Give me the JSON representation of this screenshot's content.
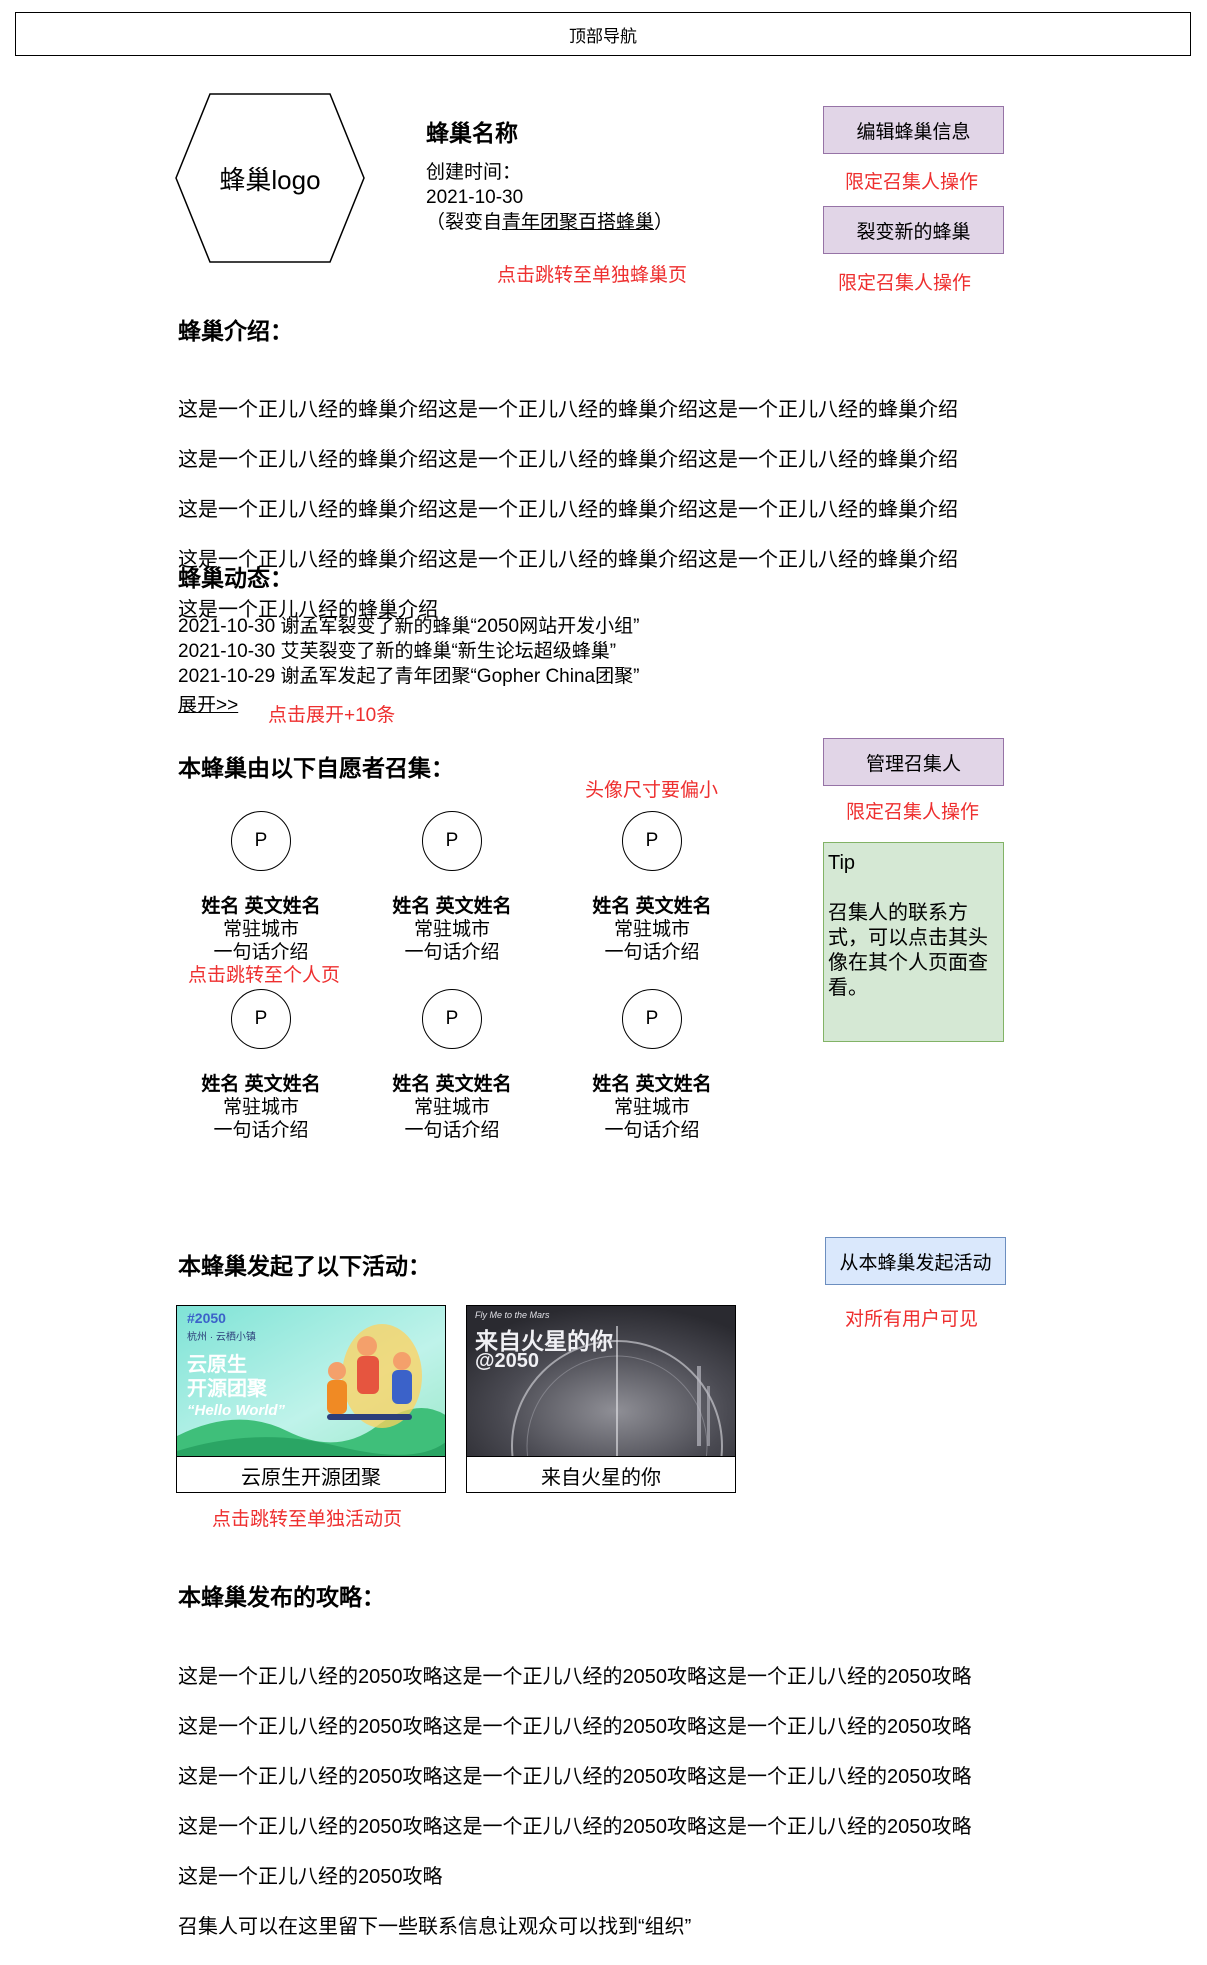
{
  "top_nav": {
    "label": "顶部导航"
  },
  "hive": {
    "logo_label": "蜂巢logo",
    "name": "蜂巢名称",
    "created_label": "创建时间：",
    "created_date": "2021-10-30",
    "forked_prefix": "（裂变自",
    "forked_link": "青年团聚百搭蜂巢",
    "forked_suffix": "）",
    "jump_note": "点击跳转至单独蜂巢页"
  },
  "actions": {
    "edit_button": "编辑蜂巢信息",
    "edit_note": "限定召集人操作",
    "fork_button": "裂变新的蜂巢",
    "fork_note": "限定召集人操作"
  },
  "intro": {
    "title": "蜂巢介绍：",
    "lines": [
      "这是一个正儿八经的蜂巢介绍这是一个正儿八经的蜂巢介绍这是一个正儿八经的蜂巢介绍",
      "这是一个正儿八经的蜂巢介绍这是一个正儿八经的蜂巢介绍这是一个正儿八经的蜂巢介绍",
      "这是一个正儿八经的蜂巢介绍这是一个正儿八经的蜂巢介绍这是一个正儿八经的蜂巢介绍",
      "这是一个正儿八经的蜂巢介绍这是一个正儿八经的蜂巢介绍这是一个正儿八经的蜂巢介绍",
      "这是一个正儿八经的蜂巢介绍"
    ]
  },
  "feed": {
    "title": "蜂巢动态：",
    "items": [
      "2021-10-30 谢孟军裂变了新的蜂巢“2050网站开发小组”",
      "2021-10-30 艾芙裂变了新的蜂巢“新生论坛超级蜂巢”",
      "2021-10-29 谢孟军发起了青年团聚“Gopher China团聚”"
    ],
    "expand_label": "展开>>",
    "expand_note": "点击展开+10条"
  },
  "conveners": {
    "title": "本蜂巢由以下自愿者召集：",
    "manage_button": "管理召集人",
    "manage_note": "限定召集人操作",
    "avatar_note": "头像尺寸要偏小",
    "person_note": "点击跳转至个人页",
    "people": [
      {
        "avatar": "P",
        "name": "姓名 英文姓名",
        "city": "常驻城市",
        "bio": "一句话介绍"
      },
      {
        "avatar": "P",
        "name": "姓名 英文姓名",
        "city": "常驻城市",
        "bio": "一句话介绍"
      },
      {
        "avatar": "P",
        "name": "姓名 英文姓名",
        "city": "常驻城市",
        "bio": "一句话介绍"
      },
      {
        "avatar": "P",
        "name": "姓名 英文姓名",
        "city": "常驻城市",
        "bio": "一句话介绍"
      },
      {
        "avatar": "P",
        "name": "姓名 英文姓名",
        "city": "常驻城市",
        "bio": "一句话介绍"
      },
      {
        "avatar": "P",
        "name": "姓名 英文姓名",
        "city": "常驻城市",
        "bio": "一句话介绍"
      }
    ],
    "tip": {
      "title": "Tip",
      "body": "召集人的联系方式，可以点击其头像在其个人页面查看。"
    }
  },
  "activities": {
    "title": "本蜂巢发起了以下活动：",
    "start_button": "从本蜂巢发起活动",
    "start_note": "对所有用户可见",
    "card_note": "点击跳转至单独活动页",
    "cards": [
      {
        "caption": "云原生开源团聚",
        "poster_badge": "#2050",
        "poster_sub": "杭州 · 云栖小镇",
        "poster_line1": "云原生",
        "poster_line2": "开源团聚",
        "poster_line3": "“Hello World”"
      },
      {
        "caption": "来自火星的你",
        "poster_small": "Fly Me to the Mars",
        "poster_line1": "来自火星的你",
        "poster_line2": "@2050"
      }
    ]
  },
  "guides": {
    "title": "本蜂巢发布的攻略：",
    "lines": [
      "这是一个正儿八经的2050攻略这是一个正儿八经的2050攻略这是一个正儿八经的2050攻略",
      "这是一个正儿八经的2050攻略这是一个正儿八经的2050攻略这是一个正儿八经的2050攻略",
      "这是一个正儿八经的2050攻略这是一个正儿八经的2050攻略这是一个正儿八经的2050攻略",
      "这是一个正儿八经的2050攻略这是一个正儿八经的2050攻略这是一个正儿八经的2050攻略",
      "这是一个正儿八经的2050攻略",
      "召集人可以在这里留下一些联系信息让观众可以找到“组织”"
    ]
  }
}
